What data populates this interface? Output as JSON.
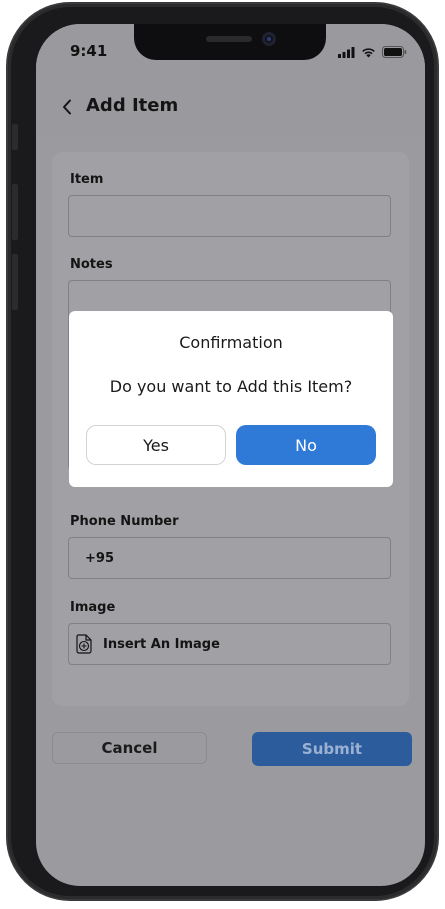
{
  "status_bar": {
    "time": "9:41",
    "icons": [
      "signal-icon",
      "wifi-icon",
      "battery-icon"
    ]
  },
  "header": {
    "title": "Add Item",
    "back_icon": "chevron-left-icon"
  },
  "form": {
    "item_label": "Item",
    "item_value": "",
    "notes_label": "Notes",
    "notes_value": "",
    "phone_label": "Phone Number",
    "phone_value": "+95",
    "image_label": "Image",
    "image_placeholder": "Insert An Image",
    "image_icon": "file-plus-icon"
  },
  "footer": {
    "cancel_label": "Cancel",
    "submit_label": "Submit"
  },
  "dialog": {
    "title": "Confirmation",
    "message": "Do you want to Add this Item?",
    "yes_label": "Yes",
    "no_label": "No"
  },
  "colors": {
    "primary": "#2f7ad6",
    "scrim_overlay": "#9b9b9f"
  }
}
